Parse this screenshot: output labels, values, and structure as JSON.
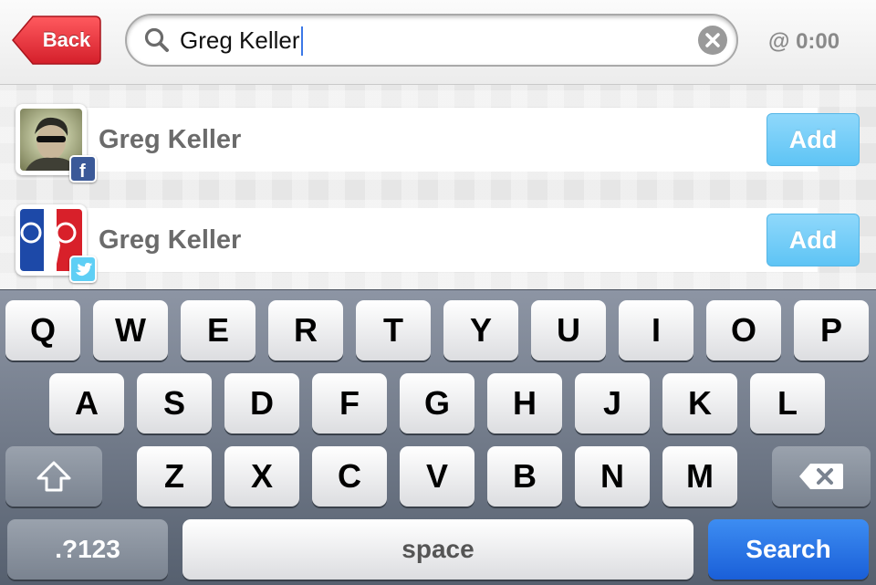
{
  "header": {
    "back_label": "Back",
    "search_value": "Greg Keller",
    "timer": "@ 0:00"
  },
  "results": [
    {
      "name": "Greg Keller",
      "source": "facebook",
      "source_icon": "facebook-icon",
      "add_label": "Add"
    },
    {
      "name": "Greg Keller",
      "source": "twitter",
      "source_icon": "twitter-icon",
      "add_label": "Add"
    }
  ],
  "keyboard": {
    "row1": [
      "Q",
      "W",
      "E",
      "R",
      "T",
      "Y",
      "U",
      "I",
      "O",
      "P"
    ],
    "row2": [
      "A",
      "S",
      "D",
      "F",
      "G",
      "H",
      "J",
      "K",
      "L"
    ],
    "row3": [
      "Z",
      "X",
      "C",
      "V",
      "B",
      "N",
      "M"
    ],
    "numbers_label": ".?123",
    "space_label": "space",
    "search_label": "Search"
  },
  "colors": {
    "back_button": "#e8313a",
    "add_button": "#6fcbf7",
    "search_key": "#2a74e4",
    "facebook": "#3b5998",
    "twitter": "#33ccff"
  }
}
